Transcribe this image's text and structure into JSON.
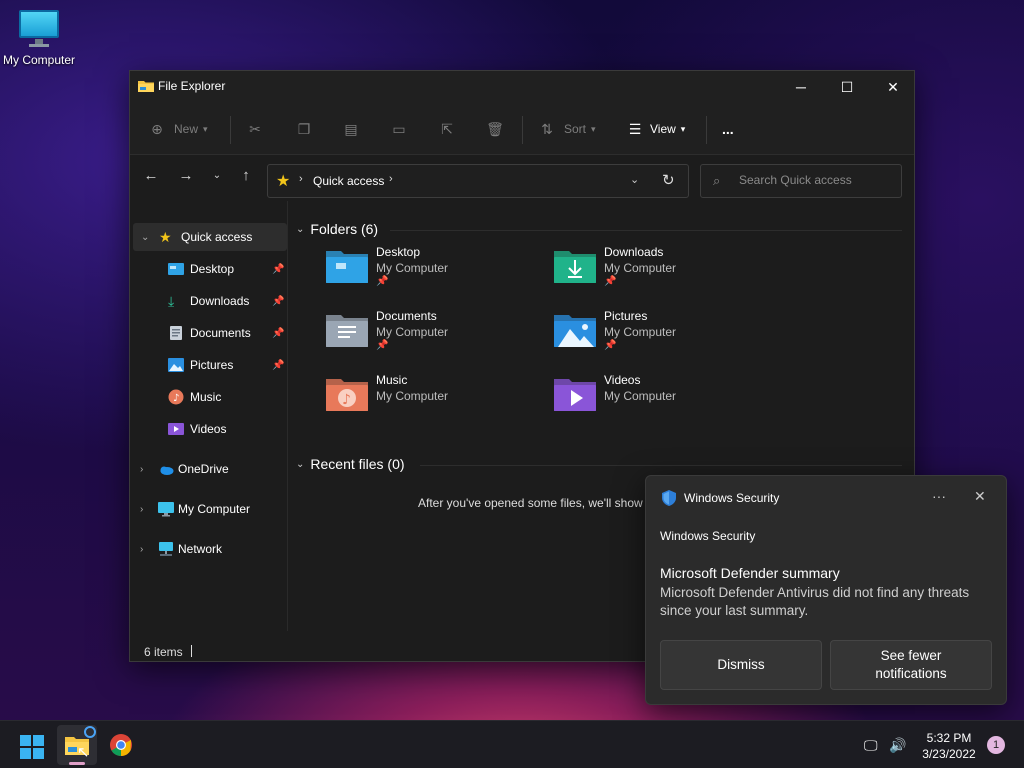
{
  "desktop": {
    "icon_label": "My Computer"
  },
  "window": {
    "title": "File Explorer",
    "toolbar": {
      "new_label": "New",
      "sort_label": "Sort",
      "view_label": "View",
      "more_label": "..."
    },
    "address": {
      "path": "Quick access"
    },
    "search": {
      "placeholder": "Search Quick access"
    },
    "sidebar": {
      "quick_access": "Quick access",
      "pinned": [
        "Desktop",
        "Downloads",
        "Documents",
        "Pictures"
      ],
      "music": "Music",
      "videos": "Videos",
      "onedrive": "OneDrive",
      "my_computer": "My Computer",
      "network": "Network"
    },
    "folders_header": "Folders (6)",
    "folders": [
      {
        "name": "Desktop",
        "location": "My Computer",
        "pinned": true,
        "color": "#2fa3e6"
      },
      {
        "name": "Downloads",
        "location": "My Computer",
        "pinned": true,
        "color": "#20b38a"
      },
      {
        "name": "Documents",
        "location": "My Computer",
        "pinned": true,
        "color": "#9aa6b4"
      },
      {
        "name": "Pictures",
        "location": "My Computer",
        "pinned": true,
        "color": "#2a8fe0"
      },
      {
        "name": "Music",
        "location": "My Computer",
        "pinned": false,
        "color": "#e8795a"
      },
      {
        "name": "Videos",
        "location": "My Computer",
        "pinned": false,
        "color": "#8a55d8"
      }
    ],
    "recent_header": "Recent files (0)",
    "recent_empty": "After you've opened some files, we'll show",
    "status": "6 items"
  },
  "toast": {
    "app_name": "Windows Security",
    "source": "Windows Security",
    "title": "Microsoft Defender summary",
    "body": "Microsoft Defender Antivirus did not find any threats since your last summary.",
    "dismiss": "Dismiss",
    "fewer": "See fewer notifications",
    "more_label": "···",
    "close_label": "✕"
  },
  "taskbar": {
    "time": "5:32 PM",
    "date": "3/23/2022",
    "notification_count": "1"
  }
}
